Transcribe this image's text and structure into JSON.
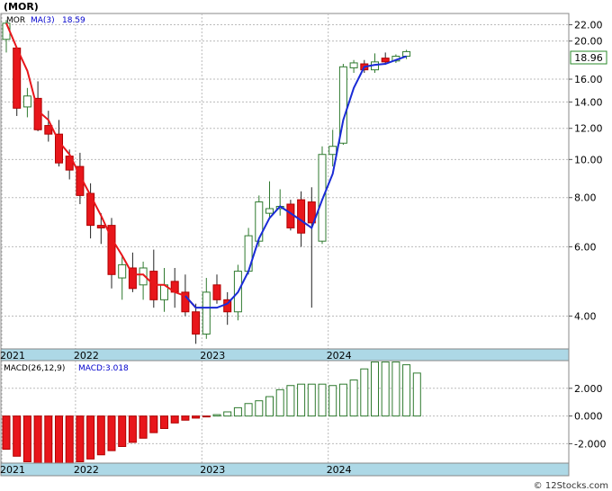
{
  "chart_data": [
    {
      "type": "candlestick",
      "title": "(MOR)",
      "ma_label": "MA(3)",
      "ma_series_label": "MOR",
      "ma_value": "18.59",
      "last_price": "18.96",
      "scale": "log",
      "ylim": [
        3.3,
        23.5
      ],
      "yticks": [
        4.0,
        6.0,
        8.0,
        10.0,
        12.0,
        14.0,
        16.0,
        20.0,
        22.0
      ],
      "ytick_labels": [
        "4.00",
        "6.00",
        "8.00",
        "10.00",
        "12.00",
        "14.00",
        "16.00",
        "20.00",
        "22.00"
      ],
      "x_labels": [
        "2021",
        "2022",
        "2023",
        "2024"
      ],
      "x_label_index": [
        0,
        7,
        19,
        31
      ],
      "candles": [
        {
          "o": 20.2,
          "h": 22.6,
          "l": 18.7,
          "c": 22.2
        },
        {
          "o": 19.2,
          "h": 19.3,
          "l": 12.9,
          "c": 13.5
        },
        {
          "o": 13.6,
          "h": 15.2,
          "l": 12.8,
          "c": 14.5
        },
        {
          "o": 14.3,
          "h": 15.8,
          "l": 11.8,
          "c": 11.9
        },
        {
          "o": 12.2,
          "h": 13.3,
          "l": 11.1,
          "c": 11.6
        },
        {
          "o": 11.6,
          "h": 12.6,
          "l": 9.6,
          "c": 9.8
        },
        {
          "o": 10.2,
          "h": 10.6,
          "l": 8.9,
          "c": 9.4
        },
        {
          "o": 9.6,
          "h": 10.4,
          "l": 7.7,
          "c": 8.1
        },
        {
          "o": 8.2,
          "h": 8.7,
          "l": 6.3,
          "c": 6.8
        },
        {
          "o": 6.8,
          "h": 7.3,
          "l": 6.1,
          "c": 6.7
        },
        {
          "o": 6.8,
          "h": 7.1,
          "l": 4.7,
          "c": 5.1
        },
        {
          "o": 5.0,
          "h": 5.7,
          "l": 4.4,
          "c": 5.4
        },
        {
          "o": 5.3,
          "h": 5.8,
          "l": 4.6,
          "c": 4.7
        },
        {
          "o": 4.8,
          "h": 5.5,
          "l": 4.4,
          "c": 5.3
        },
        {
          "o": 5.2,
          "h": 5.9,
          "l": 4.2,
          "c": 4.4
        },
        {
          "o": 4.4,
          "h": 5.3,
          "l": 4.1,
          "c": 4.8
        },
        {
          "o": 4.9,
          "h": 5.3,
          "l": 4.2,
          "c": 4.6
        },
        {
          "o": 4.6,
          "h": 5.1,
          "l": 4.0,
          "c": 4.1
        },
        {
          "o": 4.1,
          "h": 4.3,
          "l": 3.4,
          "c": 3.6
        },
        {
          "o": 3.6,
          "h": 5.0,
          "l": 3.5,
          "c": 4.6
        },
        {
          "o": 4.8,
          "h": 5.1,
          "l": 4.3,
          "c": 4.4
        },
        {
          "o": 4.4,
          "h": 4.6,
          "l": 3.8,
          "c": 4.1
        },
        {
          "o": 4.1,
          "h": 5.4,
          "l": 3.9,
          "c": 5.2
        },
        {
          "o": 5.2,
          "h": 6.7,
          "l": 5.1,
          "c": 6.4
        },
        {
          "o": 6.2,
          "h": 8.1,
          "l": 6.0,
          "c": 7.8
        },
        {
          "o": 7.3,
          "h": 8.8,
          "l": 7.1,
          "c": 7.5
        },
        {
          "o": 7.5,
          "h": 8.4,
          "l": 7.2,
          "c": 7.6
        },
        {
          "o": 7.7,
          "h": 7.9,
          "l": 6.6,
          "c": 6.7
        },
        {
          "o": 7.9,
          "h": 8.3,
          "l": 6.0,
          "c": 6.5
        },
        {
          "o": 7.8,
          "h": 8.5,
          "l": 4.2,
          "c": 6.9
        },
        {
          "o": 6.2,
          "h": 10.8,
          "l": 6.1,
          "c": 10.3
        },
        {
          "o": 10.3,
          "h": 11.9,
          "l": 9.6,
          "c": 10.8
        },
        {
          "o": 11.0,
          "h": 17.5,
          "l": 10.9,
          "c": 17.2
        },
        {
          "o": 17.1,
          "h": 17.9,
          "l": 16.6,
          "c": 17.6
        },
        {
          "o": 17.5,
          "h": 17.9,
          "l": 16.6,
          "c": 16.9
        },
        {
          "o": 16.9,
          "h": 18.6,
          "l": 16.6,
          "c": 17.7
        },
        {
          "o": 18.1,
          "h": 18.7,
          "l": 17.4,
          "c": 17.7
        },
        {
          "o": 17.8,
          "h": 18.5,
          "l": 17.6,
          "c": 18.3
        },
        {
          "o": 18.3,
          "h": 19.0,
          "l": 18.0,
          "c": 18.8
        }
      ],
      "ma3": [
        22.2,
        19.2,
        16.8,
        13.3,
        12.6,
        11.1,
        10.3,
        9.1,
        8.1,
        7.2,
        6.3,
        5.7,
        5.1,
        5.1,
        4.8,
        4.8,
        4.6,
        4.5,
        4.2,
        4.2,
        4.2,
        4.3,
        4.6,
        5.2,
        6.3,
        7.1,
        7.6,
        7.3,
        7.0,
        6.7,
        7.9,
        9.2,
        12.6,
        15.2,
        17.2,
        17.4,
        17.5,
        17.9,
        18.3
      ],
      "ma3_red_until": 17,
      "ma3_blue_from": 18
    },
    {
      "type": "bar",
      "title": "MACD(26,12,9)",
      "macd_label": "MACD:3.018",
      "ylim": [
        -3.4,
        4.0
      ],
      "yticks": [
        -2.0,
        0.0,
        2.0
      ],
      "ytick_labels": [
        "-2.000",
        "0.000",
        "2.000"
      ],
      "x_labels": [
        "2021",
        "2022",
        "2023",
        "2024"
      ],
      "values": [
        -2.4,
        -2.9,
        -3.3,
        -3.6,
        -3.7,
        -3.6,
        -3.5,
        -3.3,
        -3.1,
        -2.8,
        -2.5,
        -2.2,
        -1.9,
        -1.6,
        -1.2,
        -0.9,
        -0.5,
        -0.3,
        -0.15,
        -0.05,
        0.1,
        0.3,
        0.6,
        0.9,
        1.1,
        1.4,
        1.9,
        2.2,
        2.3,
        2.3,
        2.3,
        2.2,
        2.3,
        2.6,
        3.4,
        3.9,
        3.9,
        3.9,
        3.7,
        3.1
      ]
    }
  ],
  "watermark": "© 12Stocks.com"
}
